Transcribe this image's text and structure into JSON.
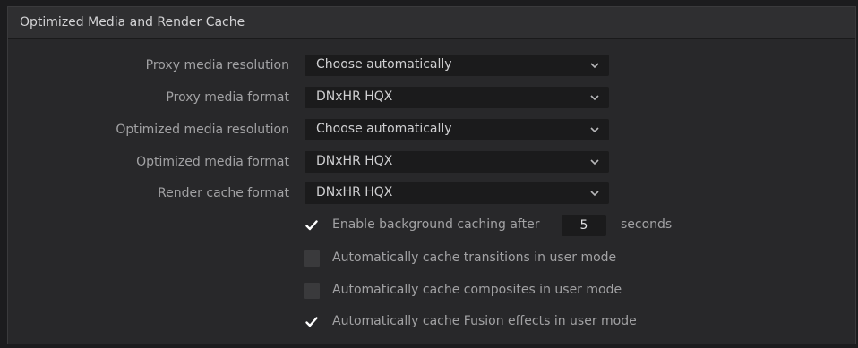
{
  "panel": {
    "title": "Optimized Media and Render Cache"
  },
  "settings": [
    {
      "label": "Proxy media resolution",
      "value": "Choose automatically"
    },
    {
      "label": "Proxy media format",
      "value": "DNxHR HQX"
    },
    {
      "label": "Optimized media resolution",
      "value": "Choose automatically"
    },
    {
      "label": "Optimized media format",
      "value": "DNxHR HQX"
    },
    {
      "label": "Render cache format",
      "value": "DNxHR HQX"
    }
  ],
  "options": {
    "background_caching": {
      "label": "Enable background caching after",
      "checked": true,
      "seconds": "5",
      "unit": "seconds"
    },
    "cache_transitions": {
      "label": "Automatically cache transitions in user mode",
      "checked": false
    },
    "cache_composites": {
      "label": "Automatically cache composites in user mode",
      "checked": false
    },
    "cache_fusion": {
      "label": "Automatically cache Fusion effects in user mode",
      "checked": true
    }
  },
  "icons": {
    "dropdown": "chevron-down-icon",
    "check": "checkmark-icon"
  },
  "colors": {
    "panel_bg": "#28282a",
    "field_bg": "#1b1b1c",
    "label_text": "#a2a2a4",
    "value_text": "#d0d0d2"
  }
}
